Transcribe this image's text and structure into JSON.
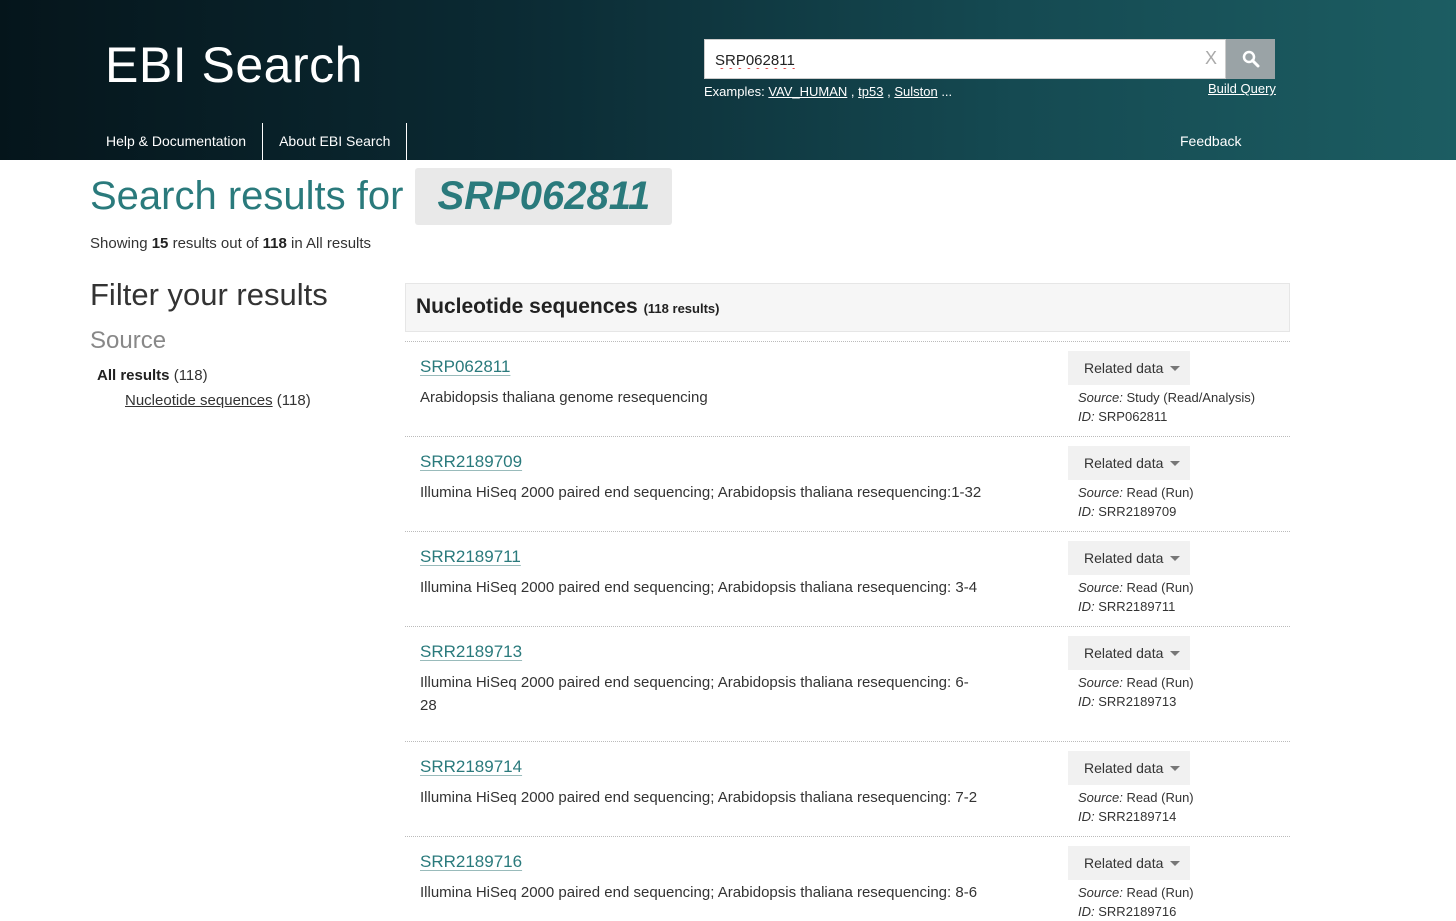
{
  "header": {
    "site_title": "EBI Search",
    "search_value": "SRP062811",
    "clear_label": "X",
    "examples_label": "Examples:",
    "examples": [
      "VAV_HUMAN",
      "tp53",
      "Sulston"
    ],
    "examples_more": "...",
    "build_query": "Build Query",
    "nav": [
      "Help & Documentation",
      "About EBI Search"
    ],
    "feedback": "Feedback"
  },
  "main": {
    "heading_prefix": "Search results for",
    "query": "SRP062811",
    "showing_prefix": "Showing",
    "showing_count": "15",
    "showing_mid": "results out of",
    "showing_total": "118",
    "showing_suffix": "in All results"
  },
  "filters": {
    "title": "Filter your results",
    "source_title": "Source",
    "all_label": "All results",
    "all_count": "(118)",
    "sub_label": "Nucleotide sequences",
    "sub_count": "(118)"
  },
  "results_panel": {
    "title": "Nucleotide sequences",
    "count": "(118 results)",
    "related_label": "Related data",
    "source_label": "Source:",
    "id_label": "ID:",
    "items": [
      {
        "id": "SRP062811",
        "desc": "Arabidopsis thaliana genome resequencing",
        "source": "Study (Read/Analysis)",
        "meta_id": "SRP062811"
      },
      {
        "id": "SRR2189709",
        "desc": "Illumina HiSeq 2000 paired end sequencing; Arabidopsis thaliana resequencing:1-32",
        "source": "Read (Run)",
        "meta_id": "SRR2189709"
      },
      {
        "id": "SRR2189711",
        "desc": "Illumina HiSeq 2000 paired end sequencing; Arabidopsis thaliana resequencing: 3-4",
        "source": "Read (Run)",
        "meta_id": "SRR2189711"
      },
      {
        "id": "SRR2189713",
        "desc": "Illumina HiSeq 2000 paired end sequencing; Arabidopsis thaliana resequencing: 6-28",
        "source": "Read (Run)",
        "meta_id": "SRR2189713"
      },
      {
        "id": "SRR2189714",
        "desc": "Illumina HiSeq 2000 paired end sequencing; Arabidopsis thaliana resequencing: 7-2",
        "source": "Read (Run)",
        "meta_id": "SRR2189714"
      },
      {
        "id": "SRR2189716",
        "desc": "Illumina HiSeq 2000 paired end sequencing; Arabidopsis thaliana resequencing: 8-6",
        "source": "Read (Run)",
        "meta_id": "SRR2189716"
      }
    ]
  }
}
